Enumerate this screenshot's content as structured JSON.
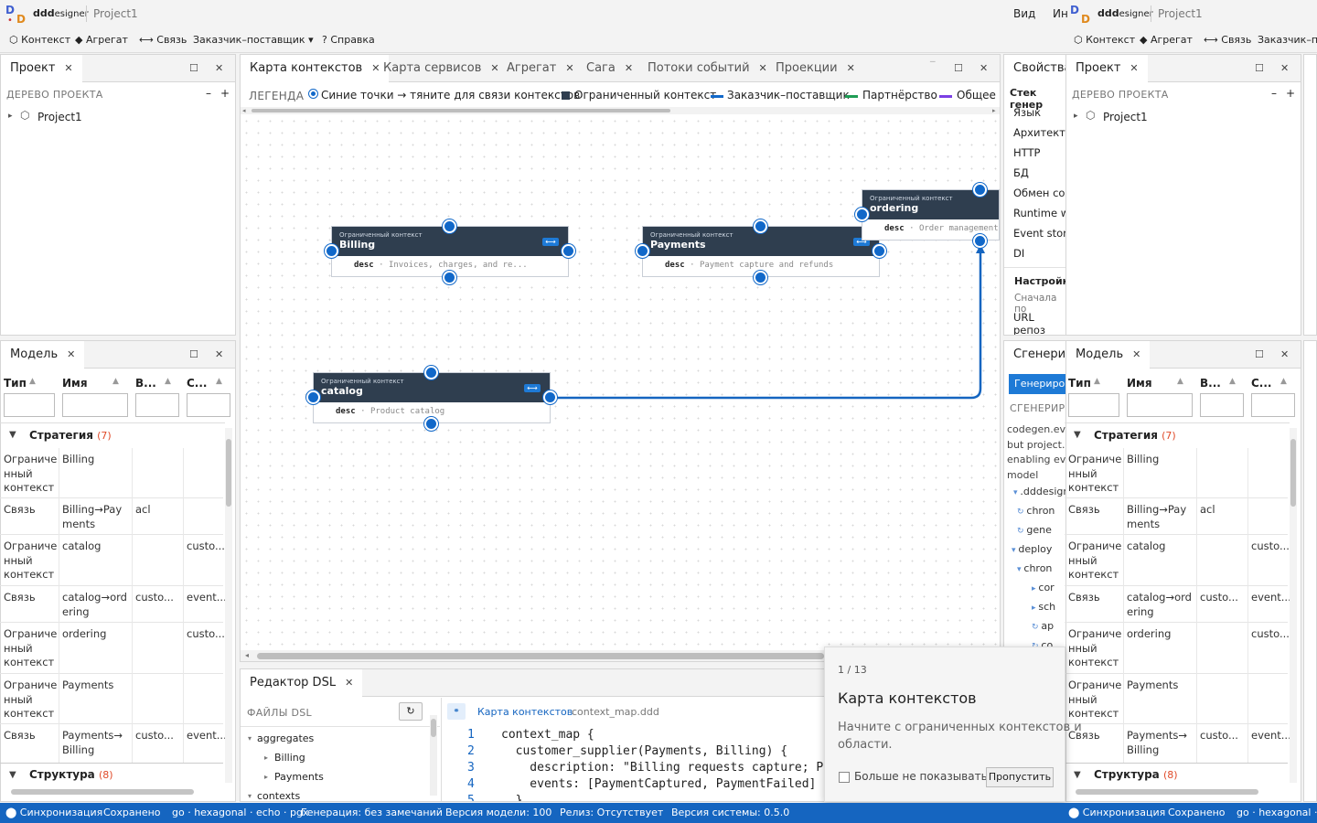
{
  "app": {
    "logo": "dddesigner",
    "logo_prefix": "ddd",
    "logo_suffix": "esigner",
    "project": "Project1",
    "menu_view": "Вид",
    "menu_cut": "Ин"
  },
  "toolbar": {
    "context": "⬡ Контекст",
    "aggregate": "◆ Агрегат",
    "link": "⟷ Связь",
    "customer": "Заказчик–поставщик ▾",
    "help": "? Справка"
  },
  "left_top": {
    "tab": "Проект",
    "section": "ДЕРЕВО ПРОЕКТА",
    "item": "Project1",
    "minus": "–",
    "plus": "+"
  },
  "center_tabs": [
    "Карта контекстов",
    "Карта сервисов",
    "Агрегат",
    "Сага",
    "Потоки событий",
    "Проекции"
  ],
  "legend": {
    "title": "ЛЕГЕНДА",
    "items": [
      "Синие точки → тяните для связи контекстов",
      "Ограниченный контекст",
      "Заказчик–поставщик",
      "Партнёрство",
      "Общее я"
    ]
  },
  "nodes": [
    {
      "kind": "Ограниченный контекст",
      "name": "Billing",
      "desc_key": "desc",
      "desc": "Invoices, charges, and re..."
    },
    {
      "kind": "Ограниченный контекст",
      "name": "Payments",
      "desc_key": "desc",
      "desc": "Payment capture and refunds"
    },
    {
      "kind": "Ограниченный контекст",
      "name": "ordering",
      "desc_key": "desc",
      "desc": "Order management"
    },
    {
      "kind": "Ограниченный контекст",
      "name": "catalog",
      "desc_key": "desc",
      "desc": "Product catalog"
    }
  ],
  "model": {
    "tab": "Модель",
    "cols": [
      "Тип",
      "Имя",
      "В...",
      "С..."
    ],
    "group1": "Стратегия",
    "group1_count": "(7)",
    "group2": "Структура",
    "group2_count": "(8)",
    "rows": [
      [
        "Ограниченный контекст",
        "Billing",
        "",
        ""
      ],
      [
        "Связь",
        "Billing→Payments",
        "acl",
        ""
      ],
      [
        "Ограниченный контекст",
        "catalog",
        "",
        "custo..."
      ],
      [
        "Связь",
        "catalog→ordering",
        "custo...",
        "event..."
      ],
      [
        "Ограниченный контекст",
        "ordering",
        "",
        "custo..."
      ],
      [
        "Ограниченный контекст",
        "Payments",
        "",
        ""
      ],
      [
        "Связь",
        "Payments→Billing",
        "custo...",
        "event..."
      ]
    ],
    "row_lines": [
      [
        "Ограниче",
        "нный",
        "контекст"
      ],
      [
        "Связь"
      ],
      [
        "Ограниче",
        "нный",
        "контекст"
      ],
      [
        "Связь"
      ],
      [
        "Ограниче",
        "нный",
        "контекст"
      ],
      [
        "Ограниче",
        "нный",
        "контекст"
      ],
      [
        "Связь"
      ]
    ],
    "name_lines": [
      [
        "Billing"
      ],
      [
        "Billing→Pay",
        "ments"
      ],
      [
        "catalog"
      ],
      [
        "catalog→ord",
        "ering"
      ],
      [
        "ordering"
      ],
      [
        "Payments"
      ],
      [
        "Payments→",
        "Billing"
      ]
    ]
  },
  "dsl": {
    "tab": "Редактор DSL",
    "files_title": "ФАЙЛЫ DSL",
    "tree": [
      "aggregates",
      "Billing",
      "Payments",
      "contexts"
    ],
    "crumb": "Карта контекстов",
    "file": "context_map.ddd",
    "lines": [
      "context_map {",
      "  customer_supplier(Payments, Billing) {",
      "    description: \"Billing requests capture; P",
      "    events: [PaymentCaptured, PaymentFailed]",
      "  }"
    ],
    "nums": [
      "1",
      "2",
      "3",
      "4",
      "5"
    ]
  },
  "right_props": {
    "tab1": "Свойства",
    "tab2": "Проект",
    "section": "Стек генер",
    "items": [
      "Язык",
      "Архитекту",
      "HTTP",
      "БД",
      "Обмен сос",
      "Runtime w",
      "Event store",
      "DI"
    ],
    "settings": "Настройки",
    "settings_hint": "Сначала по",
    "url": "URL репоз"
  },
  "right_gen": {
    "tab": "Сгенерир",
    "btn": "Генериров",
    "section": "СГЕНЕРИРО",
    "desc": [
      "codegen.even",
      "but project.e",
      "enabling even",
      "model"
    ],
    "tree": [
      ".dddesign",
      "chron",
      "gene",
      "deploy",
      "chron",
      "cor",
      "sch",
      "ap",
      "co"
    ]
  },
  "tour": {
    "step": "1 / 13",
    "title": "Карта контекстов",
    "text1": "Начните с ограниченных контекстов и",
    "text2": "области.",
    "checkbox": "Больше не показывать",
    "skip": "Пропустить"
  },
  "status": {
    "items": [
      "⬤ Синхронизация",
      "Сохранено",
      "go · hexagonal · echo · pgx",
      "Генерация: без замечаний",
      "Версия модели: 100",
      "Релиз: Отсутствует",
      "Версия системы: 0.5.0"
    ],
    "dup": [
      "⬤ Синхронизация",
      "Сохранено",
      "go · hexagonal · e"
    ]
  },
  "colors": {
    "accent": "#1565c0",
    "node_header": "#2f3e4f",
    "handle": "#1168c9",
    "partnership": "#1f9d55",
    "shared": "#7b3fe4"
  }
}
